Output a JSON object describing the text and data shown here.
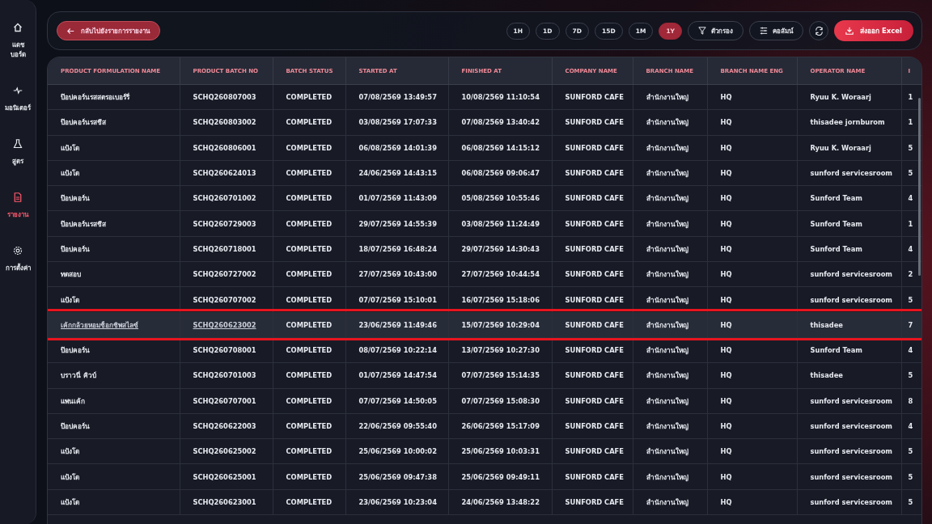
{
  "sidebar": {
    "items": [
      {
        "label": "แดช\nบอร์ด",
        "selected": false
      },
      {
        "label": "มอนิเตอร์",
        "selected": false
      },
      {
        "label": "สูตร",
        "selected": false
      },
      {
        "label": "รายงาน",
        "selected": true
      },
      {
        "label": "การตั้งค่า",
        "selected": false
      }
    ]
  },
  "toolbar": {
    "back_button": "กลับไปยังรายการรายงาน",
    "ranges": [
      {
        "label": "1H",
        "selected": false
      },
      {
        "label": "1D",
        "selected": false
      },
      {
        "label": "7D",
        "selected": false
      },
      {
        "label": "15D",
        "selected": false
      },
      {
        "label": "1M",
        "selected": false
      },
      {
        "label": "1Y",
        "selected": true
      }
    ],
    "filter_button": "ตัวกรอง",
    "columns_button": "คอลัมน์",
    "export_button": "ส่งออก Excel"
  },
  "table": {
    "columns": [
      "PRODUCT FORMULATION NAME",
      "PRODUCT BATCH NO",
      "BATCH STATUS",
      "STARTED AT",
      "FINISHED AT",
      "COMPANY NAME",
      "BRANCH NAME",
      "BRANCH NAME ENG",
      "OPERATOR NAME",
      "I"
    ],
    "rows": [
      {
        "selected": false,
        "cells": [
          "ป๊อปคอร์นรสสตรอเบอร์รี่",
          "SCHQ260807003",
          "COMPLETED",
          "07/08/2569 13:49:57",
          "10/08/2569 11:10:54",
          "SUNFORD CAFE",
          "สำนักงานใหญ่",
          "HQ",
          "Ryuu K. Woraarj",
          "1"
        ]
      },
      {
        "selected": false,
        "cells": [
          "ป๊อปคอร์นรสชีส",
          "SCHQ260803002",
          "COMPLETED",
          "03/08/2569 17:07:33",
          "07/08/2569 13:40:42",
          "SUNFORD CAFE",
          "สำนักงานใหญ่",
          "HQ",
          "thisadee jornburom",
          "1"
        ]
      },
      {
        "selected": false,
        "cells": [
          "แป้งโด",
          "SCHQ260806001",
          "COMPLETED",
          "06/08/2569 14:01:39",
          "06/08/2569 14:15:12",
          "SUNFORD CAFE",
          "สำนักงานใหญ่",
          "HQ",
          "Ryuu K. Woraarj",
          "5"
        ]
      },
      {
        "selected": false,
        "cells": [
          "แป้งโด",
          "SCHQ260624013",
          "COMPLETED",
          "24/06/2569 14:43:15",
          "06/08/2569 09:06:47",
          "SUNFORD CAFE",
          "สำนักงานใหญ่",
          "HQ",
          "sunford servicesroom",
          "5"
        ]
      },
      {
        "selected": false,
        "cells": [
          "ป๊อปคอร์น",
          "SCHQ260701002",
          "COMPLETED",
          "01/07/2569 11:43:09",
          "05/08/2569 10:55:46",
          "SUNFORD CAFE",
          "สำนักงานใหญ่",
          "HQ",
          "Sunford Team",
          "4"
        ]
      },
      {
        "selected": false,
        "cells": [
          "ป๊อปคอร์นรสชีส",
          "SCHQ260729003",
          "COMPLETED",
          "29/07/2569 14:55:39",
          "03/08/2569 11:24:49",
          "SUNFORD CAFE",
          "สำนักงานใหญ่",
          "HQ",
          "Sunford Team",
          "1"
        ]
      },
      {
        "selected": false,
        "cells": [
          "ป๊อปคอร์น",
          "SCHQ260718001",
          "COMPLETED",
          "18/07/2569 16:48:24",
          "29/07/2569 14:30:43",
          "SUNFORD CAFE",
          "สำนักงานใหญ่",
          "HQ",
          "Sunford Team",
          "4"
        ]
      },
      {
        "selected": false,
        "cells": [
          "ทดสอบ",
          "SCHQ260727002",
          "COMPLETED",
          "27/07/2569 10:43:00",
          "27/07/2569 10:44:54",
          "SUNFORD CAFE",
          "สำนักงานใหญ่",
          "HQ",
          "sunford servicesroom",
          "2"
        ]
      },
      {
        "selected": false,
        "cells": [
          "แป้งโด",
          "SCHQ260707002",
          "COMPLETED",
          "07/07/2569 15:10:01",
          "16/07/2569 15:18:06",
          "SUNFORD CAFE",
          "สำนักงานใหญ่",
          "HQ",
          "sunford servicesroom",
          "5"
        ]
      },
      {
        "selected": true,
        "cells": [
          "เค้กกล้วยหอมช็อกชิพสไลซ์",
          "SCHQ260623002",
          "COMPLETED",
          "23/06/2569 11:49:46",
          "15/07/2569 10:29:04",
          "SUNFORD CAFE",
          "สำนักงานใหญ่",
          "HQ",
          "thisadee",
          "7"
        ]
      },
      {
        "selected": false,
        "cells": [
          "ป๊อปคอร์น",
          "SCHQ260708001",
          "COMPLETED",
          "08/07/2569 10:22:14",
          "13/07/2569 10:27:30",
          "SUNFORD CAFE",
          "สำนักงานใหญ่",
          "HQ",
          "Sunford Team",
          "4"
        ]
      },
      {
        "selected": false,
        "cells": [
          "บราวนี่ คิวบ์",
          "SCHQ260701003",
          "COMPLETED",
          "01/07/2569 14:47:54",
          "07/07/2569 15:14:35",
          "SUNFORD CAFE",
          "สำนักงานใหญ่",
          "HQ",
          "thisadee",
          "5"
        ]
      },
      {
        "selected": false,
        "cells": [
          "แพนเค้ก",
          "SCHQ260707001",
          "COMPLETED",
          "07/07/2569 14:50:05",
          "07/07/2569 15:08:30",
          "SUNFORD CAFE",
          "สำนักงานใหญ่",
          "HQ",
          "sunford servicesroom",
          "8"
        ]
      },
      {
        "selected": false,
        "cells": [
          "ป๊อปคอร์น",
          "SCHQ260622003",
          "COMPLETED",
          "22/06/2569 09:55:40",
          "26/06/2569 15:17:09",
          "SUNFORD CAFE",
          "สำนักงานใหญ่",
          "HQ",
          "sunford servicesroom",
          "4"
        ]
      },
      {
        "selected": false,
        "cells": [
          "แป้งโด",
          "SCHQ260625002",
          "COMPLETED",
          "25/06/2569 10:00:02",
          "25/06/2569 10:03:31",
          "SUNFORD CAFE",
          "สำนักงานใหญ่",
          "HQ",
          "sunford servicesroom",
          "5"
        ]
      },
      {
        "selected": false,
        "cells": [
          "แป้งโด",
          "SCHQ260625001",
          "COMPLETED",
          "25/06/2569 09:47:38",
          "25/06/2569 09:49:11",
          "SUNFORD CAFE",
          "สำนักงานใหญ่",
          "HQ",
          "sunford servicesroom",
          "5"
        ]
      },
      {
        "selected": false,
        "cells": [
          "แป้งโด",
          "SCHQ260623001",
          "COMPLETED",
          "23/06/2569 10:23:04",
          "24/06/2569 13:48:22",
          "SUNFORD CAFE",
          "สำนักงานใหญ่",
          "HQ",
          "sunford servicesroom",
          "5"
        ]
      }
    ]
  }
}
